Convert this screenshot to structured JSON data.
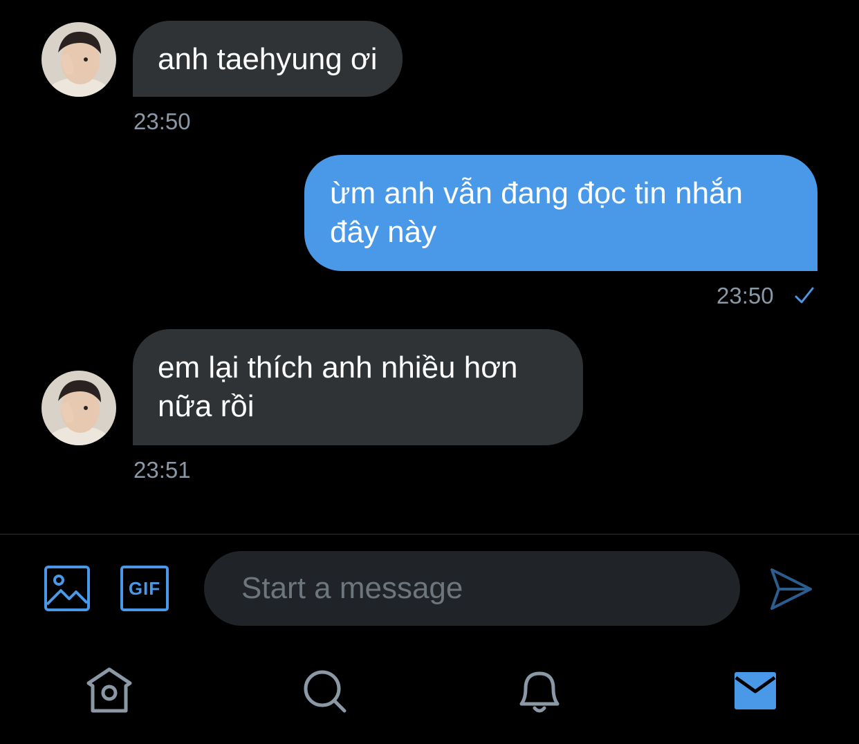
{
  "colors": {
    "background": "#000000",
    "received_bubble": "#2f3336",
    "sent_bubble": "#4a99e9",
    "timestamp": "#8b98a5",
    "accent": "#4a99e9",
    "icon_inactive": "#8b98a5"
  },
  "messages": [
    {
      "direction": "received",
      "lines": [
        "anh taehyung ơi"
      ],
      "time": "23:50"
    },
    {
      "direction": "sent",
      "lines": [
        "ừm anh vẫn đang đọc tin nhắn",
        "đây này"
      ],
      "time": "23:50",
      "status": "sent-check"
    },
    {
      "direction": "received",
      "lines": [
        "em lại thích anh nhiều hơn",
        "nữa rồi"
      ],
      "time": "23:51"
    }
  ],
  "composer": {
    "placeholder": "Start a message",
    "value": "",
    "gif_label": "GIF",
    "icons": [
      "image-icon",
      "gif-icon",
      "send-icon"
    ]
  },
  "bottom_nav": {
    "items": [
      {
        "name": "home",
        "icon": "home-icon",
        "active": false
      },
      {
        "name": "search",
        "icon": "search-icon",
        "active": false
      },
      {
        "name": "notifications",
        "icon": "bell-icon",
        "active": false
      },
      {
        "name": "messages",
        "icon": "mail-icon",
        "active": true
      }
    ]
  }
}
